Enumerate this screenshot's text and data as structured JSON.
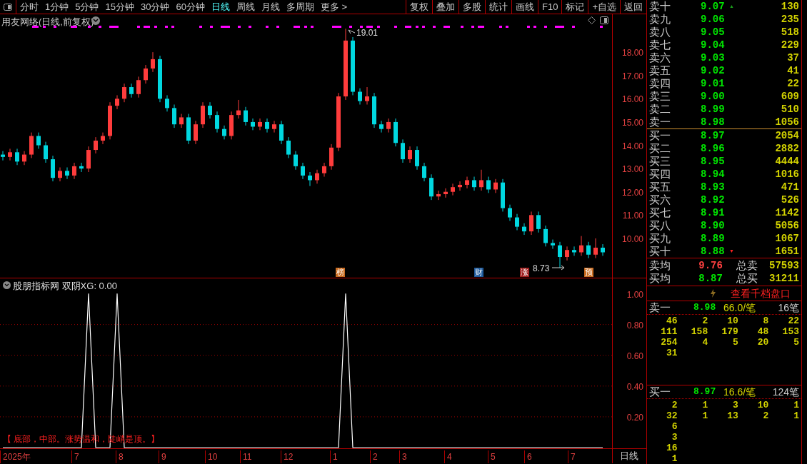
{
  "toolbar": {
    "periods": [
      {
        "label": "分时",
        "selected": false
      },
      {
        "label": "1分钟",
        "selected": false
      },
      {
        "label": "5分钟",
        "selected": false
      },
      {
        "label": "15分钟",
        "selected": false
      },
      {
        "label": "30分钟",
        "selected": false
      },
      {
        "label": "60分钟",
        "selected": false
      },
      {
        "label": "日线",
        "selected": true
      },
      {
        "label": "周线",
        "selected": false
      },
      {
        "label": "月线",
        "selected": false
      },
      {
        "label": "多周期",
        "selected": false
      },
      {
        "label": "更多 >",
        "selected": false
      }
    ],
    "actions": [
      "复权",
      "叠加",
      "多股",
      "统计",
      "画线",
      "F10",
      "标记",
      "+自选",
      "返回"
    ]
  },
  "price_chart": {
    "title": "用友网络(日线,前复权)",
    "high_label": "19.01",
    "low_label": "8.73",
    "events": [
      {
        "label": "榜",
        "color": "#c86a1e"
      },
      {
        "label": "财",
        "color": "#1e5a9c"
      },
      {
        "label": "涨",
        "color": "#a01e1e"
      },
      {
        "label": "预",
        "color": "#c86a1e"
      }
    ],
    "chart_data": {
      "type": "candlestick",
      "ylim": [
        8.31,
        19.63
      ],
      "ohlc": [
        [
          13.6,
          13.75,
          13.35,
          13.5
        ],
        [
          13.5,
          13.85,
          13.35,
          13.7
        ],
        [
          13.7,
          13.85,
          13.15,
          13.3
        ],
        [
          13.3,
          13.75,
          13.15,
          13.6
        ],
        [
          13.6,
          14.55,
          13.45,
          14.4
        ],
        [
          14.4,
          14.55,
          13.85,
          14.0
        ],
        [
          14.0,
          14.15,
          13.25,
          13.4
        ],
        [
          13.4,
          13.55,
          12.45,
          12.6
        ],
        [
          12.6,
          13.05,
          12.45,
          12.9
        ],
        [
          12.9,
          13.05,
          12.55,
          12.7
        ],
        [
          12.7,
          13.25,
          12.55,
          13.1
        ],
        [
          13.1,
          13.25,
          12.85,
          13.0
        ],
        [
          13.0,
          13.95,
          12.85,
          13.8
        ],
        [
          13.8,
          14.35,
          13.65,
          14.2
        ],
        [
          14.2,
          14.55,
          14.05,
          14.4
        ],
        [
          14.4,
          15.85,
          14.25,
          15.7
        ],
        [
          15.7,
          16.15,
          15.55,
          16.0
        ],
        [
          16.0,
          16.65,
          15.85,
          16.5
        ],
        [
          16.5,
          16.65,
          16.05,
          16.2
        ],
        [
          16.2,
          16.95,
          16.05,
          16.8
        ],
        [
          16.8,
          17.45,
          16.65,
          17.3
        ],
        [
          17.3,
          18.0,
          17.15,
          17.7
        ],
        [
          17.7,
          17.85,
          15.85,
          16.0
        ],
        [
          16.0,
          16.15,
          15.45,
          15.6
        ],
        [
          15.6,
          15.75,
          14.75,
          14.9
        ],
        [
          14.9,
          15.35,
          14.75,
          15.2
        ],
        [
          15.2,
          15.35,
          14.05,
          14.2
        ],
        [
          14.2,
          15.05,
          14.05,
          14.9
        ],
        [
          14.9,
          15.85,
          14.75,
          15.7
        ],
        [
          15.7,
          15.85,
          15.15,
          15.3
        ],
        [
          15.3,
          15.45,
          14.55,
          14.7
        ],
        [
          14.7,
          14.85,
          14.25,
          14.4
        ],
        [
          14.4,
          15.45,
          14.25,
          15.3
        ],
        [
          15.3,
          15.95,
          15.15,
          15.5
        ],
        [
          15.5,
          15.65,
          14.85,
          15.0
        ],
        [
          15.0,
          15.15,
          14.65,
          14.8
        ],
        [
          14.8,
          15.15,
          14.65,
          15.0
        ],
        [
          15.0,
          15.15,
          14.55,
          14.7
        ],
        [
          14.7,
          15.05,
          14.55,
          14.9
        ],
        [
          14.9,
          15.05,
          14.05,
          14.2
        ],
        [
          14.2,
          14.35,
          13.45,
          13.6
        ],
        [
          13.6,
          13.75,
          12.95,
          13.1
        ],
        [
          13.1,
          13.25,
          12.55,
          12.7
        ],
        [
          12.7,
          12.85,
          12.25,
          12.5
        ],
        [
          12.5,
          12.95,
          12.35,
          12.8
        ],
        [
          12.8,
          13.25,
          12.65,
          13.1
        ],
        [
          13.1,
          14.05,
          12.95,
          13.9
        ],
        [
          13.9,
          16.25,
          13.75,
          16.1
        ],
        [
          16.1,
          19.01,
          15.95,
          18.5
        ],
        [
          18.5,
          18.65,
          16.15,
          16.3
        ],
        [
          16.3,
          16.45,
          15.75,
          15.9
        ],
        [
          15.9,
          16.5,
          15.75,
          16.1
        ],
        [
          16.1,
          16.25,
          14.75,
          14.9
        ],
        [
          14.9,
          15.05,
          14.55,
          14.7
        ],
        [
          14.7,
          15.15,
          14.55,
          15.0
        ],
        [
          15.0,
          15.15,
          13.95,
          14.1
        ],
        [
          14.1,
          14.25,
          13.25,
          13.4
        ],
        [
          13.4,
          13.95,
          13.25,
          13.8
        ],
        [
          13.8,
          13.95,
          12.95,
          13.1
        ],
        [
          13.1,
          13.25,
          12.45,
          12.6
        ],
        [
          12.6,
          12.75,
          11.65,
          11.8
        ],
        [
          11.8,
          12.05,
          11.65,
          11.9
        ],
        [
          11.9,
          12.15,
          11.75,
          12.0
        ],
        [
          12.0,
          12.35,
          11.85,
          12.2
        ],
        [
          12.2,
          12.45,
          12.05,
          12.3
        ],
        [
          12.3,
          12.65,
          12.15,
          12.5
        ],
        [
          12.5,
          12.65,
          12.05,
          12.2
        ],
        [
          12.2,
          12.95,
          12.05,
          12.5
        ],
        [
          12.5,
          12.65,
          11.95,
          12.1
        ],
        [
          12.1,
          12.55,
          11.95,
          12.4
        ],
        [
          12.4,
          12.55,
          11.15,
          11.3
        ],
        [
          11.3,
          11.45,
          10.75,
          10.9
        ],
        [
          10.9,
          11.05,
          10.35,
          10.5
        ],
        [
          10.5,
          10.65,
          10.15,
          10.3
        ],
        [
          10.3,
          11.15,
          10.15,
          11.0
        ],
        [
          11.0,
          11.15,
          10.25,
          10.4
        ],
        [
          10.4,
          10.55,
          9.65,
          9.8
        ],
        [
          9.8,
          9.95,
          9.55,
          9.7
        ],
        [
          9.7,
          9.85,
          8.73,
          9.2
        ],
        [
          9.2,
          9.65,
          9.05,
          9.5
        ],
        [
          9.5,
          9.65,
          9.25,
          9.4
        ],
        [
          9.4,
          10.1,
          9.25,
          9.7
        ],
        [
          9.7,
          9.85,
          9.15,
          9.3
        ],
        [
          9.3,
          10.0,
          9.15,
          9.6
        ],
        [
          9.6,
          9.75,
          9.25,
          9.4
        ]
      ],
      "yticks": [
        {
          "value": 18,
          "label": "18.00"
        },
        {
          "value": 17,
          "label": "17.00"
        },
        {
          "value": 16,
          "label": "16.00"
        },
        {
          "value": 15,
          "label": "15.00"
        },
        {
          "value": 14,
          "label": "14.00"
        },
        {
          "value": 13,
          "label": "13.00"
        },
        {
          "value": 12,
          "label": "12.00"
        },
        {
          "value": 11,
          "label": "11.00"
        },
        {
          "value": 10,
          "label": "10.00"
        }
      ]
    }
  },
  "indicator": {
    "title": "股朋指标网 双阴XG: 0.00",
    "note": "【 底部，中部。涨势温和，陡峭是顶。】",
    "chart_data": {
      "type": "line",
      "series": [
        {
          "color": "#ffffff",
          "values": [
            0,
            0,
            0,
            0,
            0,
            0,
            0,
            0,
            0,
            0,
            0,
            0,
            1,
            0,
            0,
            0,
            1,
            0,
            0,
            0,
            0,
            0,
            0,
            0,
            0,
            0,
            0,
            0,
            0,
            0,
            0,
            0,
            0,
            0,
            0,
            0,
            0,
            0,
            0,
            0,
            0,
            0,
            0,
            0,
            0,
            0,
            0,
            0,
            1,
            0,
            0,
            0,
            0,
            0,
            0,
            0,
            0,
            0,
            0,
            0,
            0,
            0,
            0,
            0,
            0,
            0,
            0,
            0,
            0,
            0,
            0,
            0,
            0,
            0,
            0,
            0,
            0,
            0,
            0,
            0,
            0,
            0,
            0,
            0,
            0
          ]
        }
      ],
      "ylim": [
        0,
        1.1
      ],
      "grid": true,
      "yticks": [
        {
          "value": 0.2,
          "label": "0.20"
        },
        {
          "value": 0.4,
          "label": "0.40"
        },
        {
          "value": 0.6,
          "label": "0.60"
        },
        {
          "value": 0.8,
          "label": "0.80"
        },
        {
          "value": 1,
          "label": "1.00"
        }
      ]
    }
  },
  "x_axis": {
    "labels": [
      "2025年",
      "7",
      "8",
      "9",
      "10",
      "11",
      "12",
      "1",
      "2",
      "3",
      "4",
      "5",
      "6",
      "7"
    ]
  },
  "period_label": "日线",
  "order_book": {
    "asks": [
      {
        "label": "卖十",
        "price": "9.07",
        "volume": "130",
        "marker": "▲"
      },
      {
        "label": "卖九",
        "price": "9.06",
        "volume": "235"
      },
      {
        "label": "卖八",
        "price": "9.05",
        "volume": "518"
      },
      {
        "label": "卖七",
        "price": "9.04",
        "volume": "229"
      },
      {
        "label": "卖六",
        "price": "9.03",
        "volume": "37"
      },
      {
        "label": "卖五",
        "price": "9.02",
        "volume": "41"
      },
      {
        "label": "卖四",
        "price": "9.01",
        "volume": "22"
      },
      {
        "label": "卖三",
        "price": "9.00",
        "volume": "609"
      },
      {
        "label": "卖二",
        "price": "8.99",
        "volume": "510"
      },
      {
        "label": "卖一",
        "price": "8.98",
        "volume": "1056"
      }
    ],
    "bids": [
      {
        "label": "买一",
        "price": "8.97",
        "volume": "2054"
      },
      {
        "label": "买二",
        "price": "8.96",
        "volume": "2882"
      },
      {
        "label": "买三",
        "price": "8.95",
        "volume": "4444"
      },
      {
        "label": "买四",
        "price": "8.94",
        "volume": "1016"
      },
      {
        "label": "买五",
        "price": "8.93",
        "volume": "471"
      },
      {
        "label": "买六",
        "price": "8.92",
        "volume": "526"
      },
      {
        "label": "买七",
        "price": "8.91",
        "volume": "1142"
      },
      {
        "label": "买八",
        "price": "8.90",
        "volume": "5056"
      },
      {
        "label": "买九",
        "price": "8.89",
        "volume": "1067"
      },
      {
        "label": "买十",
        "price": "8.88",
        "volume": "1651",
        "marker": "▼"
      }
    ],
    "averages": [
      {
        "label": "卖均",
        "price": "9.76",
        "color": "#ff4040",
        "total_label": "总卖",
        "total": "57593"
      },
      {
        "label": "买均",
        "price": "8.87",
        "color": "#00e600",
        "total_label": "总买",
        "total": "31211"
      }
    ],
    "depth_link": "查看千档盘口",
    "queues": [
      {
        "label": "卖一",
        "price": "8.98",
        "avg": "66.0/笔",
        "count": "16笔",
        "rows": [
          [
            "46",
            "2",
            "10",
            "8",
            "22"
          ],
          [
            "111",
            "158",
            "179",
            "48",
            "153"
          ],
          [
            "254",
            "4",
            "5",
            "20",
            "5"
          ],
          [
            "31"
          ]
        ]
      },
      {
        "label": "买一",
        "price": "8.97",
        "avg": "16.6/笔",
        "count": "124笔",
        "rows": [
          [
            "2",
            "1",
            "3",
            "10",
            "1"
          ],
          [
            "32",
            "1",
            "13",
            "2",
            "1"
          ],
          [
            "6"
          ],
          [
            "3"
          ],
          [
            "16"
          ],
          [
            "1"
          ]
        ]
      }
    ]
  }
}
